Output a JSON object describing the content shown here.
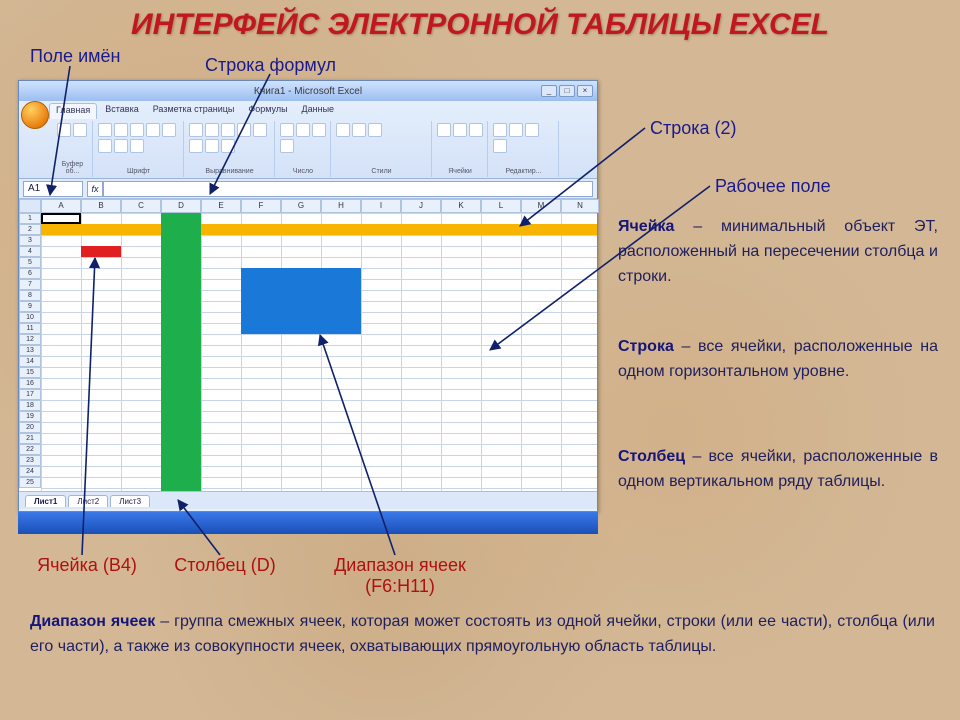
{
  "title": "ИНТЕРФЕЙС ЭЛЕКТРОННОЙ ТАБЛИЦЫ EXCEL",
  "labels": {
    "name_box": "Поле имён",
    "formula_bar": "Строка формул",
    "row2": "Строка (2)",
    "work_area": "Рабочее поле",
    "cell_b4": "Ячейка (B4)",
    "column_d": "Столбец (D)",
    "range": "Диапазон ячеек (F6:H11)"
  },
  "excel": {
    "title": "Книга1 - Microsoft Excel",
    "namebox_value": "A1",
    "tabs": [
      "Главная",
      "Вставка",
      "Разметка страницы",
      "Формулы",
      "Данные"
    ],
    "groups": [
      "Буфер об...",
      "Шрифт",
      "Выравнивание",
      "Число",
      "Стили",
      "Ячейки",
      "Редактир..."
    ],
    "columns": [
      "A",
      "B",
      "C",
      "D",
      "E",
      "F",
      "G",
      "H",
      "I",
      "J",
      "K",
      "L",
      "M",
      "N"
    ],
    "sheets": [
      "Лист1",
      "Лист2",
      "Лист3"
    ]
  },
  "definitions": {
    "cell_term": "Ячейка",
    "cell_def": " – минимальный объект ЭТ, расположенный на пересечении столбца и строки.",
    "row_term": "Строка",
    "row_def": " – все ячейки, расположенные на одном горизонтальном уровне.",
    "column_term": "Столбец",
    "column_def": " – все ячейки, расположенные в одном вертикальном ряду таблицы.",
    "range_term": "Диапазон ячеек",
    "range_def": " – группа смежных ячеек, которая может состоять из одной ячейки, строки (или ее части), столбца (или его части), а также из совокупности ячеек, охватывающих прямоугольную область таблицы."
  }
}
